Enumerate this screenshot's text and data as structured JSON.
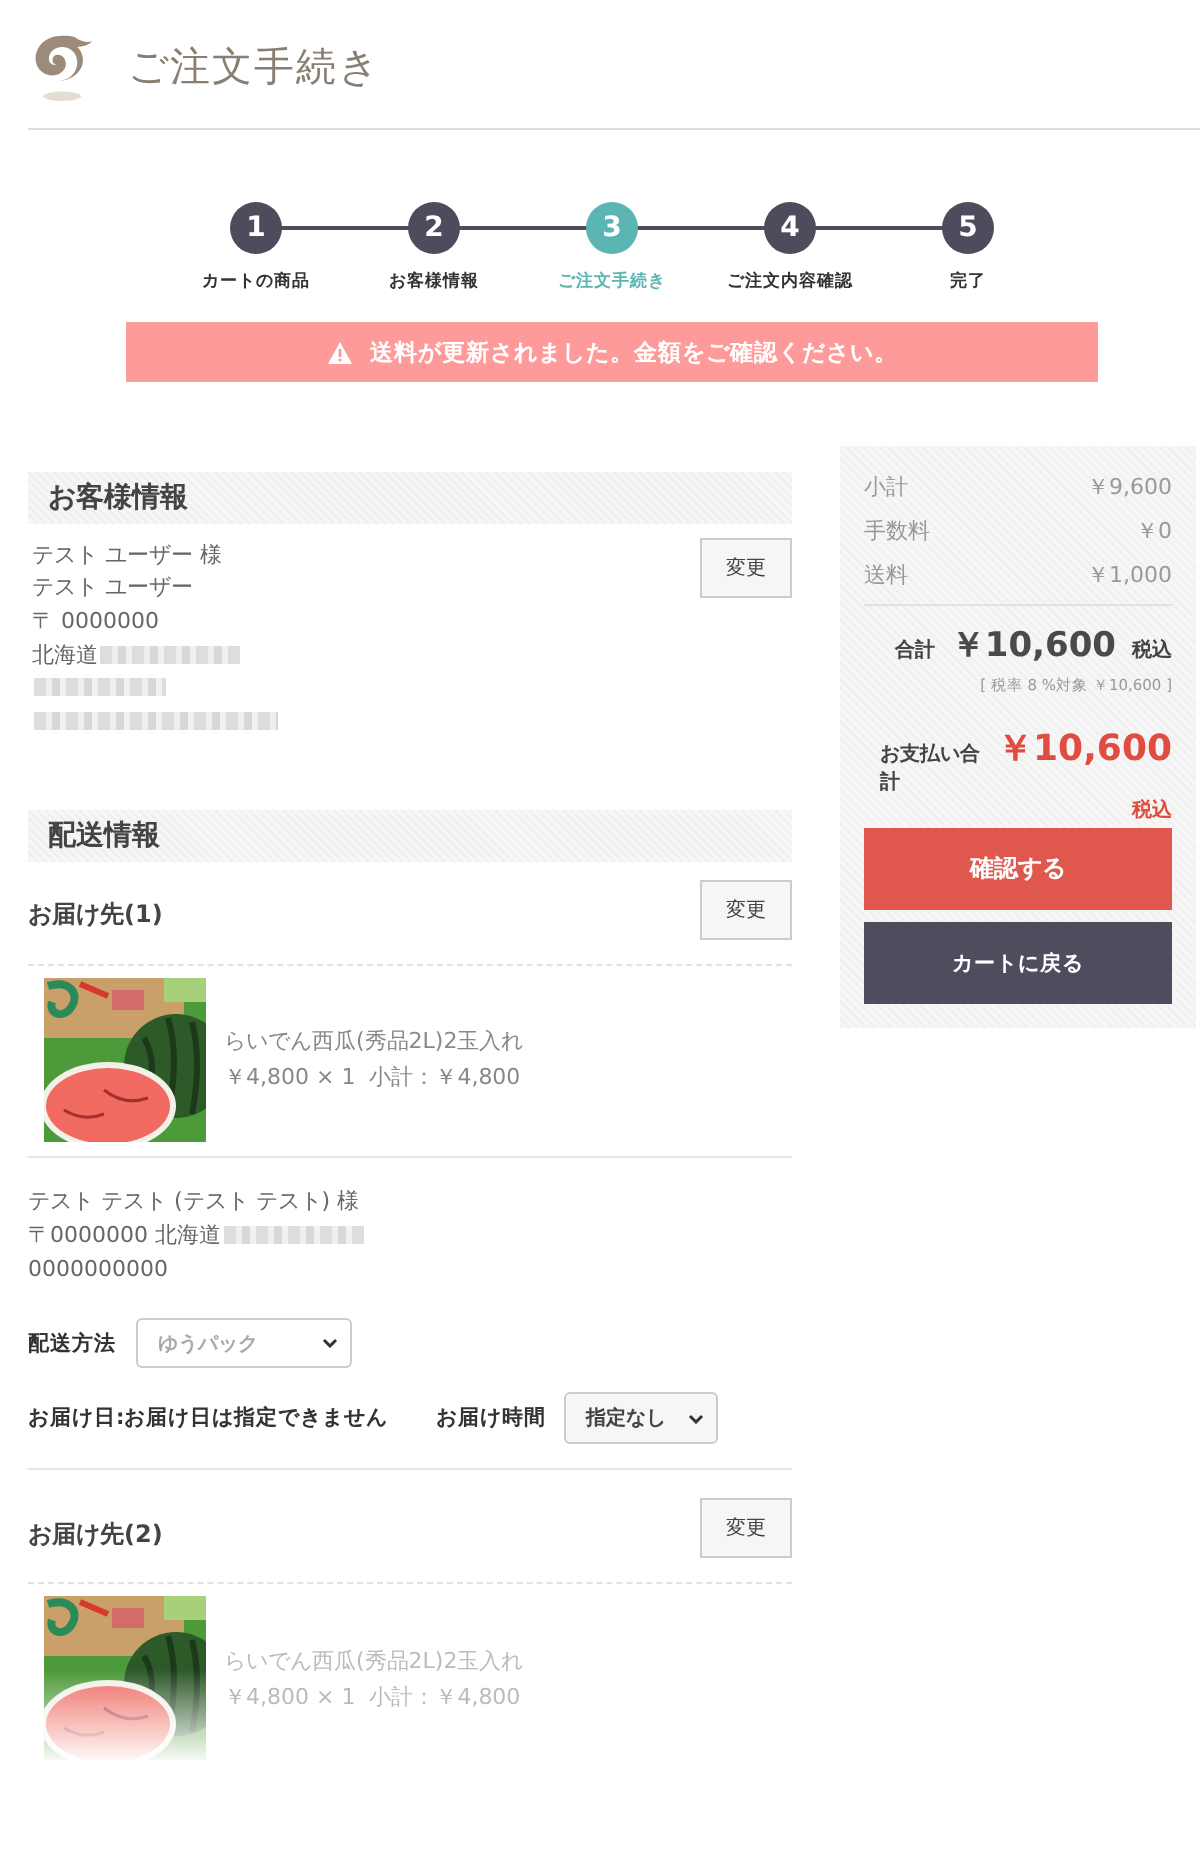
{
  "header": {
    "title": "ご注文手続き"
  },
  "steps": [
    {
      "number": "1",
      "label": "カートの商品",
      "selected": false
    },
    {
      "number": "2",
      "label": "お客様情報",
      "selected": false
    },
    {
      "number": "3",
      "label": "ご注文手続き",
      "selected": true
    },
    {
      "number": "4",
      "label": "ご注文内容確認",
      "selected": false
    },
    {
      "number": "5",
      "label": "完了",
      "selected": false
    }
  ],
  "alert": {
    "message": "送料が更新されました。金額をご確認ください。"
  },
  "customer": {
    "heading": "お客様情報",
    "change_button": "変更",
    "lines": [
      {
        "kind": "text",
        "text": "テスト ユーザー 様"
      },
      {
        "kind": "text",
        "text": "テスト ユーザー"
      },
      {
        "kind": "text",
        "text": "〒 0000000"
      },
      {
        "kind": "text_redacted",
        "text": "北海道"
      },
      {
        "kind": "redacted"
      },
      {
        "kind": "redacted"
      }
    ]
  },
  "delivery": {
    "heading": "配送情報",
    "destinations": [
      {
        "title": "お届け先(1)",
        "change_button": "変更",
        "faded": false,
        "item": {
          "name": "らいでん西瓜(秀品2L)2玉入れ",
          "price_line": "￥4,800 × 1  小計：￥4,800"
        },
        "recipient": [
          {
            "kind": "text",
            "text": "テスト テスト (テスト テスト) 様"
          },
          {
            "kind": "text_redacted",
            "text": "〒0000000 北海道"
          },
          {
            "kind": "text",
            "text": "0000000000"
          }
        ],
        "method": {
          "label": "配送方法",
          "value": "ゆうパック"
        },
        "date": {
          "text": "お届け日:お届け日は指定できません"
        },
        "time": {
          "label": "お届け時間",
          "value": "指定なし"
        }
      },
      {
        "title": "お届け先(2)",
        "change_button": "変更",
        "faded": true,
        "item": {
          "name": "らいでん西瓜(秀品2L)2玉入れ",
          "price_line": "￥4,800 × 1  小計：￥4,800"
        }
      }
    ]
  },
  "summary": {
    "rows": [
      {
        "label": "小計",
        "value": "￥9,600"
      },
      {
        "label": "手数料",
        "value": "￥0"
      },
      {
        "label": "送料",
        "value": "￥1,000"
      }
    ],
    "total": {
      "label": "合計",
      "amount": "￥10,600",
      "tax": "税込"
    },
    "tax_note": "[ 税率 8 %対象 ￥10,600 ]",
    "payment": {
      "label": "お支払い合計",
      "amount": "￥10,600",
      "tax": "税込"
    },
    "confirm_button": "確認する",
    "back_button": "カートに戻る"
  }
}
